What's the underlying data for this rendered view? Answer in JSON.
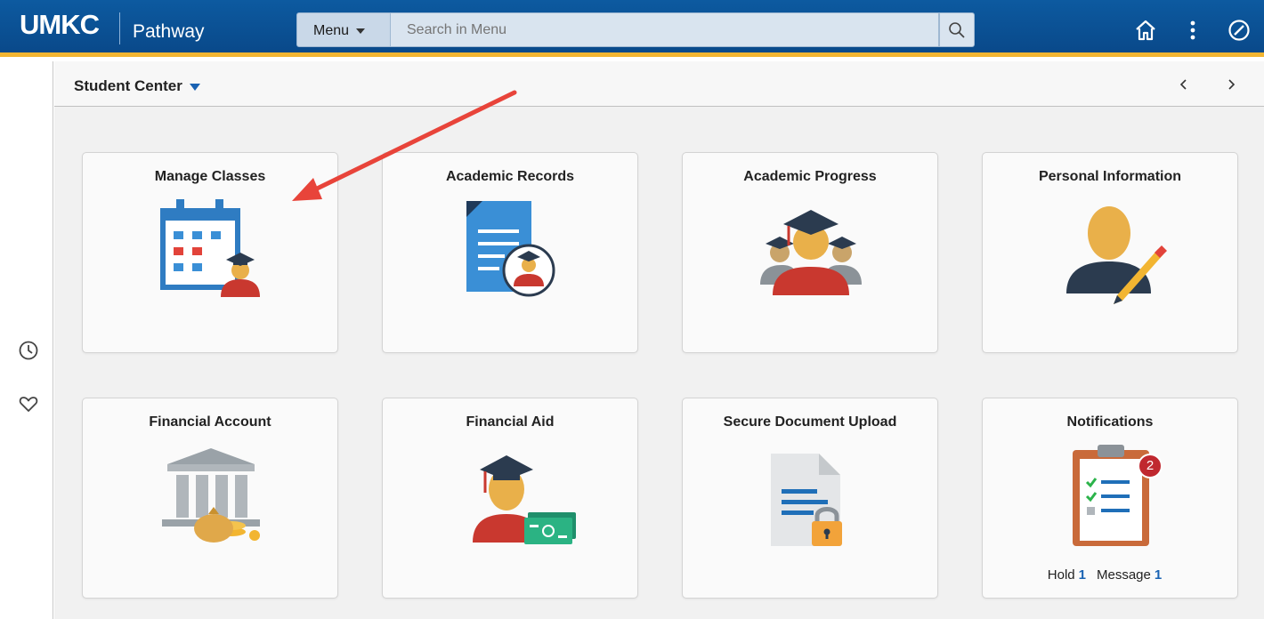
{
  "header": {
    "logo": "UMKC",
    "app_name": "Pathway",
    "menu_label": "Menu",
    "search_placeholder": "Search in Menu",
    "icons": [
      "home-icon",
      "more-vertical-icon",
      "navbar-compass-icon"
    ]
  },
  "rail": {
    "icons": [
      "recent-clock-icon",
      "favorites-heart-icon"
    ]
  },
  "subheader": {
    "title": "Student Center",
    "icons": [
      "prev-chevron-icon",
      "next-chevron-icon"
    ]
  },
  "tiles": [
    {
      "title": "Manage Classes",
      "icon": "calendar-student-icon"
    },
    {
      "title": "Academic Records",
      "icon": "document-student-icon"
    },
    {
      "title": "Academic Progress",
      "icon": "graduates-group-icon"
    },
    {
      "title": "Personal Information",
      "icon": "person-pencil-icon"
    },
    {
      "title": "Financial Account",
      "icon": "bank-money-icon"
    },
    {
      "title": "Financial Aid",
      "icon": "graduate-cash-icon"
    },
    {
      "title": "Secure Document Upload",
      "icon": "document-lock-icon"
    },
    {
      "title": "Notifications",
      "icon": "clipboard-checklist-icon",
      "badge": "2",
      "footer": {
        "hold_label": "Hold",
        "hold_count": "1",
        "message_label": "Message",
        "message_count": "1"
      }
    }
  ],
  "colors": {
    "header": "#0b5394",
    "accent": "#f2b531",
    "link": "#1a63b3",
    "annotation_arrow": "#e8443a"
  }
}
